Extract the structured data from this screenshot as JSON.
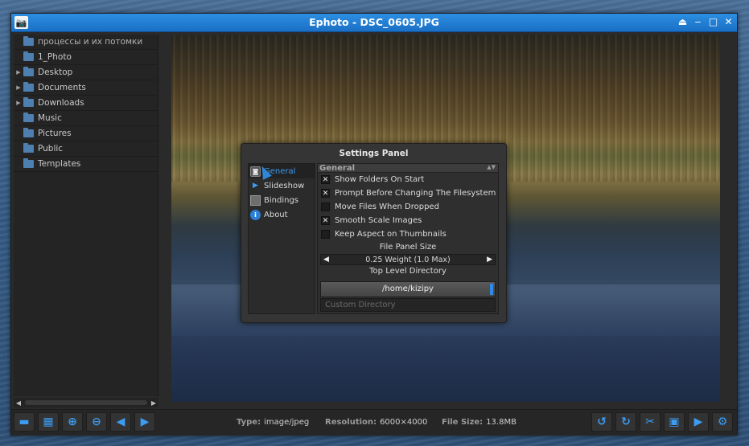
{
  "window": {
    "title": "Ephoto - DSC_0605.JPG",
    "controls": {
      "shade": "⏏",
      "minimize": "‒",
      "maximize": "□",
      "close": "✕"
    }
  },
  "file_tree": {
    "items": [
      {
        "label": "процессы и их потомки",
        "expandable": false
      },
      {
        "label": "1_Photo",
        "expandable": false
      },
      {
        "label": "Desktop",
        "expandable": true
      },
      {
        "label": "Documents",
        "expandable": true
      },
      {
        "label": "Downloads",
        "expandable": true
      },
      {
        "label": "Music",
        "expandable": false
      },
      {
        "label": "Pictures",
        "expandable": false
      },
      {
        "label": "Public",
        "expandable": false
      },
      {
        "label": "Templates",
        "expandable": false
      }
    ]
  },
  "settings": {
    "title": "Settings Panel",
    "nav": [
      {
        "label": "General",
        "icon": "general-icon"
      },
      {
        "label": "Slideshow",
        "icon": "play-icon"
      },
      {
        "label": "Bindings",
        "icon": "keyboard-icon"
      },
      {
        "label": "About",
        "icon": "info-icon"
      }
    ],
    "section_header": "General",
    "options": [
      {
        "label": "Show Folders On Start",
        "checked": true
      },
      {
        "label": "Prompt Before Changing The Filesystem",
        "checked": true
      },
      {
        "label": "Move Files When Dropped",
        "checked": false
      },
      {
        "label": "Smooth Scale Images",
        "checked": true
      },
      {
        "label": "Keep Aspect on Thumbnails",
        "checked": false
      }
    ],
    "file_panel_size_label": "File Panel Size",
    "file_panel_size_value": "0.25 Weight (1.0 Max)",
    "top_level_dir_label": "Top Level Directory",
    "top_level_dir_value": "/home/kizipy",
    "custom_dir_placeholder": "Custom Directory"
  },
  "statusbar": {
    "type_label": "Type:",
    "type_value": "image/jpeg",
    "resolution_label": "Resolution:",
    "resolution_value": "6000×4000",
    "filesize_label": "File Size:",
    "filesize_value": "13.8MB"
  },
  "toolbar": {
    "left": [
      "folder-icon",
      "grid-icon",
      "zoom-in-icon",
      "zoom-out-icon",
      "arrow-left-icon",
      "arrow-right-icon"
    ],
    "right": [
      "rotate-ccw-icon",
      "rotate-cw-icon",
      "scissors-icon",
      "save-icon",
      "play-icon",
      "settings-icon"
    ]
  },
  "colors": {
    "accent": "#2e8ae8",
    "titlebar": "#1a6fc4"
  }
}
